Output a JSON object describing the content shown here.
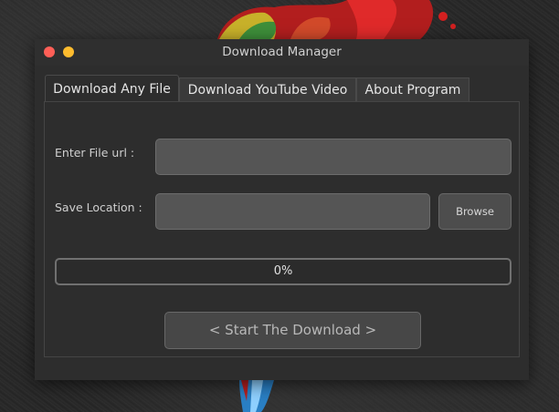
{
  "window": {
    "title": "Download Manager"
  },
  "tabs": [
    {
      "label": "Download Any File",
      "active": true
    },
    {
      "label": "Download YouTube Video",
      "active": false
    },
    {
      "label": "About Program",
      "active": false
    }
  ],
  "form": {
    "url_label": "Enter File url :",
    "url_value": "",
    "save_label": "Save Location :",
    "save_value": "",
    "browse_label": "Browse"
  },
  "progress": {
    "value": 0,
    "text": "0%"
  },
  "start_button": {
    "label": "< Start The Download >"
  },
  "colors": {
    "close": "#ff5f57",
    "minimize": "#febc2e",
    "window_bg": "#2d2d2d",
    "field_bg": "#555555"
  }
}
